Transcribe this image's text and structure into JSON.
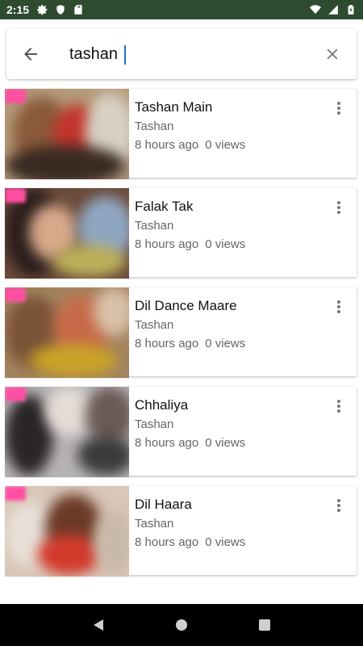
{
  "status_bar": {
    "time": "2:15",
    "icons_left": [
      "gear-icon",
      "shield-icon",
      "sd-card-icon"
    ],
    "icons_right": [
      "wifi-icon",
      "signal-icon",
      "battery-icon"
    ]
  },
  "search": {
    "query": "tashan",
    "back_icon": "arrow-back-icon",
    "clear_icon": "close-icon"
  },
  "results": [
    {
      "title": "Tashan Main",
      "artist": "Tashan",
      "time_ago": "8 hours ago",
      "views": "0 views"
    },
    {
      "title": "Falak Tak",
      "artist": "Tashan",
      "time_ago": "8 hours ago",
      "views": "0 views"
    },
    {
      "title": "Dil Dance Maare",
      "artist": "Tashan",
      "time_ago": "8 hours ago",
      "views": "0 views"
    },
    {
      "title": "Chhaliya",
      "artist": "Tashan",
      "time_ago": "8 hours ago",
      "views": "0 views"
    },
    {
      "title": "Dil Haara",
      "artist": "Tashan",
      "time_ago": "8 hours ago",
      "views": "0 views"
    }
  ],
  "colors": {
    "status_bar": "#2e4a2f",
    "accent": "#1976d2",
    "badge": "#ff4fa3"
  }
}
